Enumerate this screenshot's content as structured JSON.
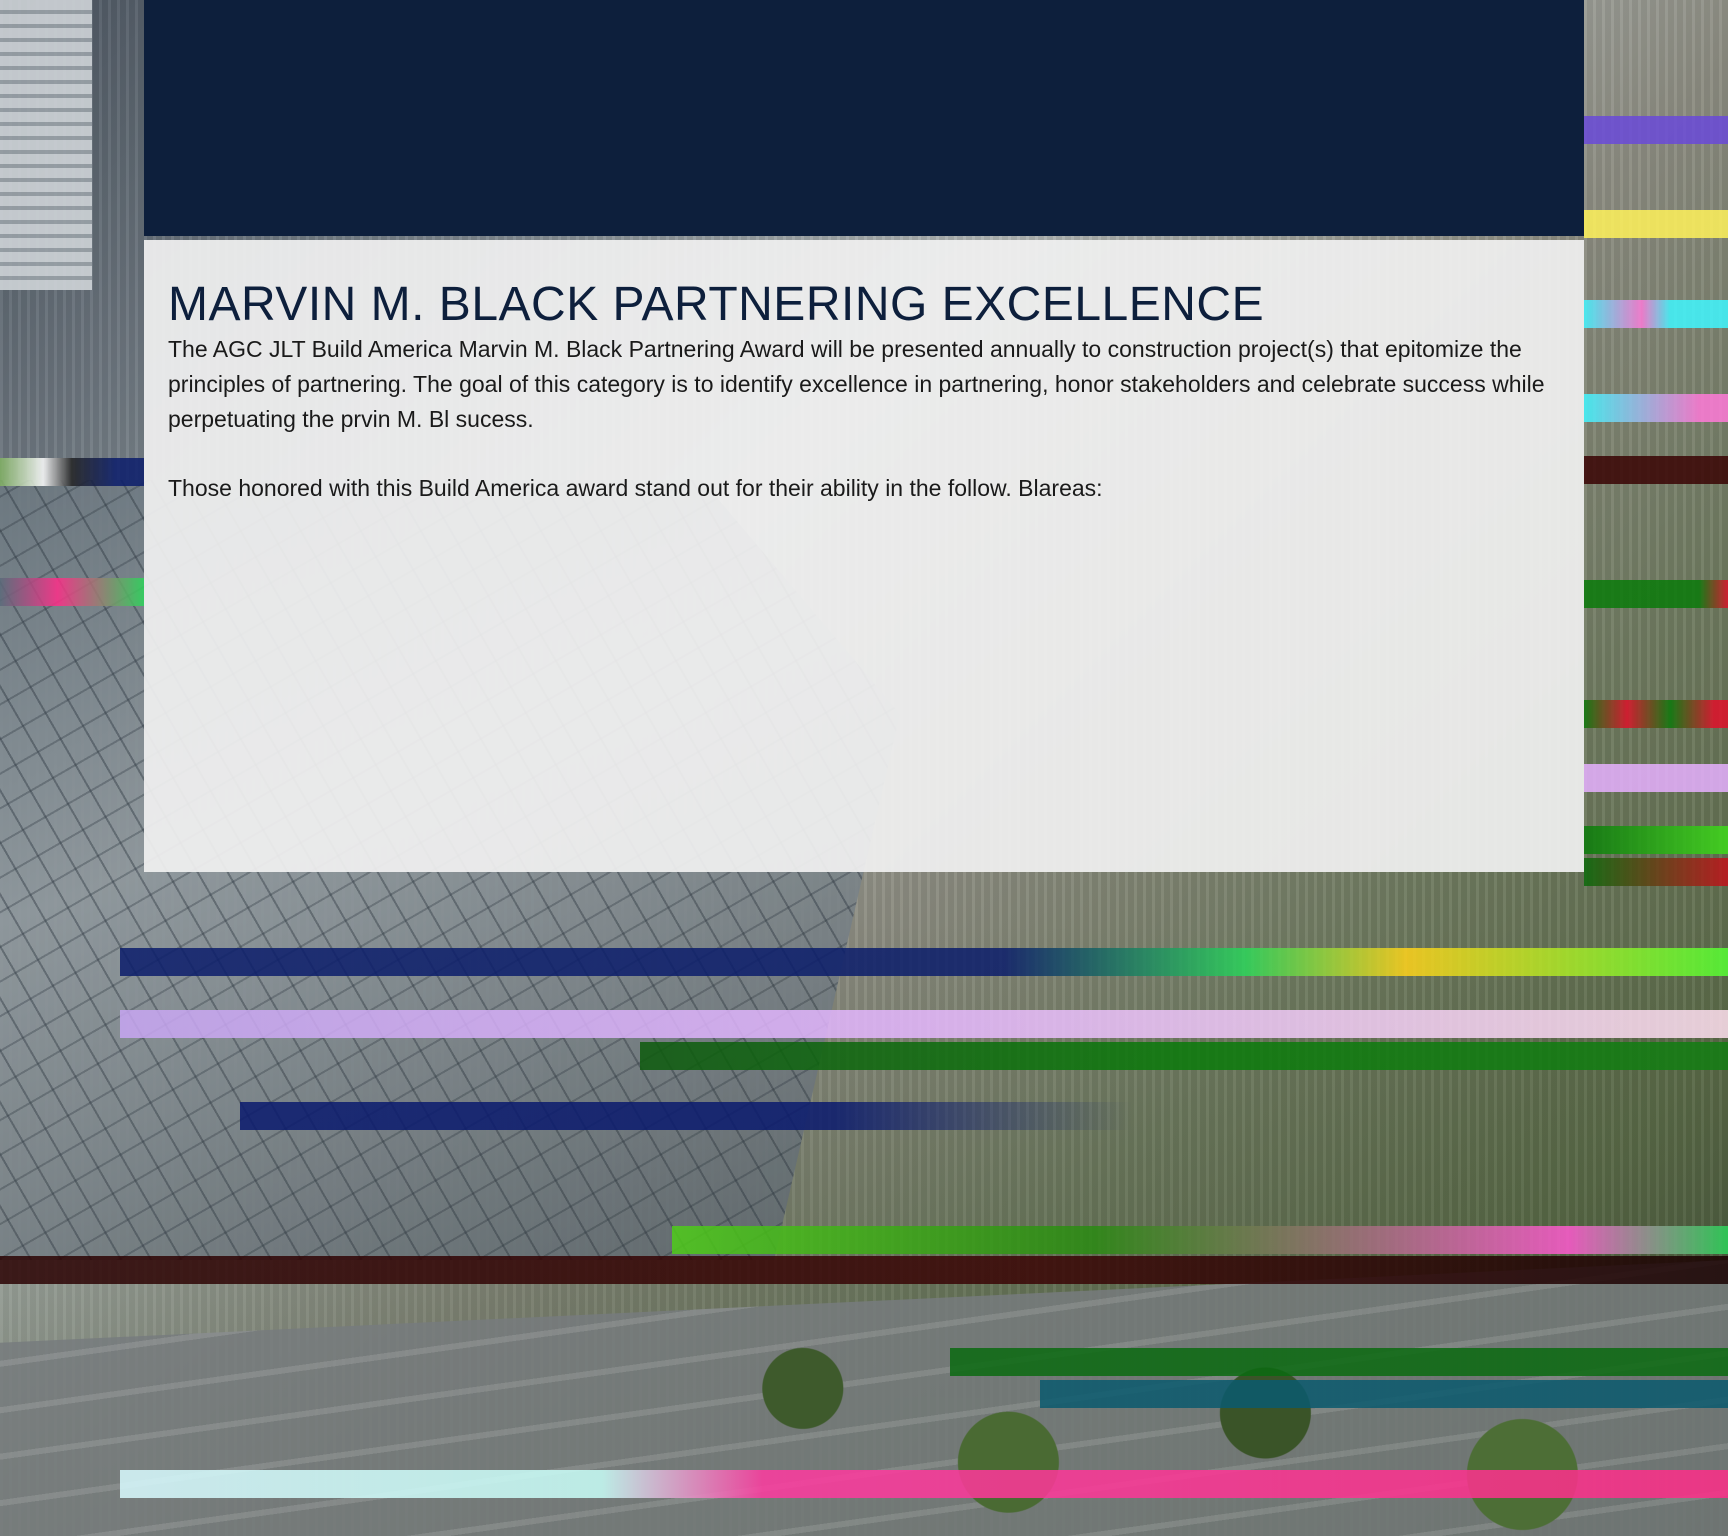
{
  "award": {
    "title": "MARVIN M. BLACK PARTNERING EXCELLENCE",
    "paragraphs": [
      "The AGC JLT Build America Marvin M. Black Partnering Award will be presented annually to construction project(s) that epitomize the principles of partnering. The goal of this category is to identify excellence in partnering, honor stakeholders and celebrate success while perpetuating the prvin M. Bl sucess.",
      "Those honored with this Build America award stand out for their ability in the follow. Blareas:"
    ]
  },
  "colors": {
    "header_band": "#0d1f3c",
    "title_text": "#0d1f3c",
    "card_background": "#f0f0f0",
    "body_text": "#1a1a1a"
  },
  "background": {
    "image": "aerial-construction-photo"
  }
}
